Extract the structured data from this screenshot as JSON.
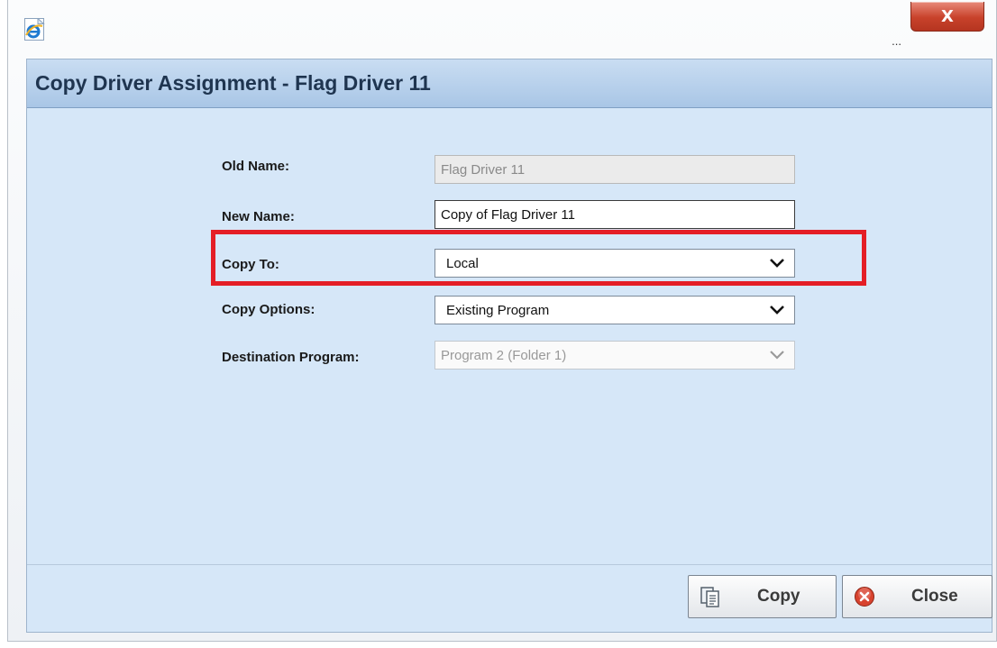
{
  "window": {
    "ellipsis": "...",
    "close_glyph": "X",
    "ie_icon": "internet-explorer-icon"
  },
  "dialog": {
    "title": "Copy Driver Assignment - Flag Driver 11"
  },
  "form": {
    "old_name": {
      "label": "Old Name:",
      "value": "Flag Driver 11"
    },
    "new_name": {
      "label": "New Name:",
      "value": "Copy of Flag Driver 11"
    },
    "copy_to": {
      "label": "Copy To:",
      "value": "Local"
    },
    "copy_options": {
      "label": "Copy Options:",
      "value": "Existing Program"
    },
    "destination_program": {
      "label": "Destination Program:",
      "value": "Program 2 (Folder 1)"
    }
  },
  "buttons": {
    "copy": {
      "label": "Copy",
      "icon": "copy-document-icon"
    },
    "close": {
      "label": "Close",
      "icon": "close-circle-icon"
    }
  },
  "colors": {
    "highlight": "#e41e26",
    "panel_bg": "#d6e7f8",
    "header_bg": "#b5cfeb"
  }
}
